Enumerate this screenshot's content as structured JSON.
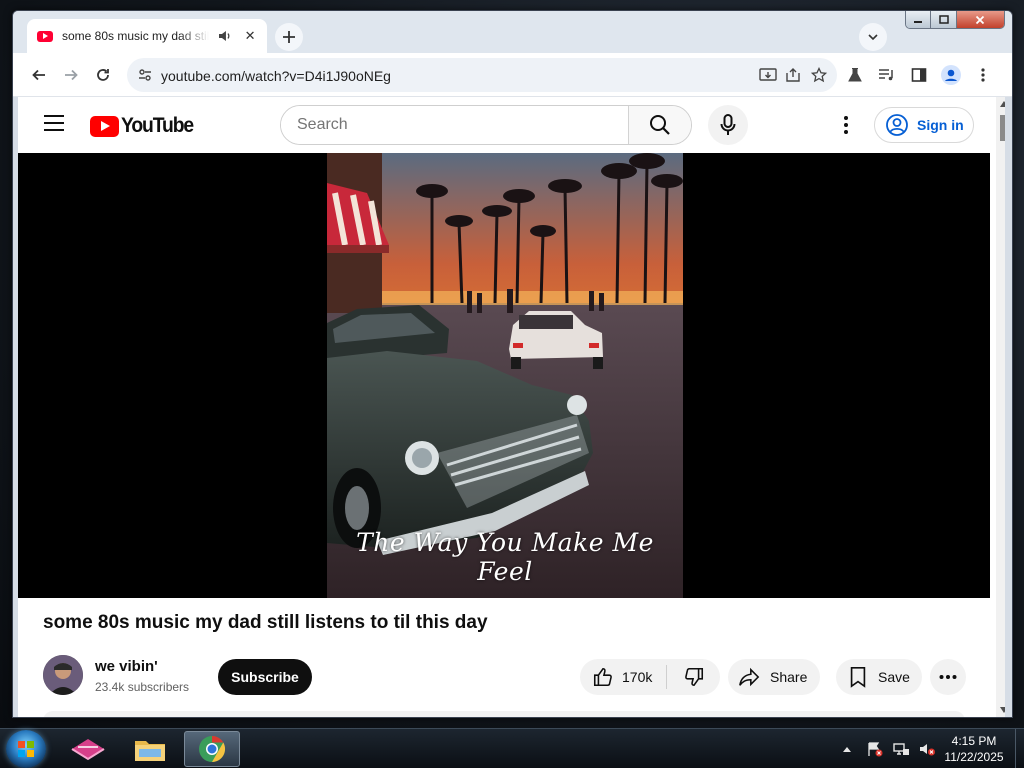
{
  "browser": {
    "tab": {
      "title": "some 80s music my dad still listens to til this day"
    },
    "url": "youtube.com/watch?v=D4i1J90oNEg"
  },
  "youtube": {
    "logo_text": "YouTube",
    "search_placeholder": "Search",
    "sign_in": "Sign in"
  },
  "video": {
    "overlay_caption": "The Way You Make Me Feel",
    "title": "some 80s music my dad still listens to til this day",
    "channel": "we vibin'",
    "subscribers": "23.4k subscribers",
    "subscribe_label": "Subscribe",
    "likes": "170k",
    "share_label": "Share",
    "save_label": "Save"
  },
  "taskbar": {
    "time": "4:15 PM",
    "date": "11/22/2025",
    "apps": [
      "app-launcher-icon",
      "file-explorer-icon",
      "chrome-icon"
    ]
  },
  "colors": {
    "youtube_red": "#ff0000",
    "sign_in_blue": "#065fd4",
    "subscribe_bg": "#0f0f0f"
  }
}
